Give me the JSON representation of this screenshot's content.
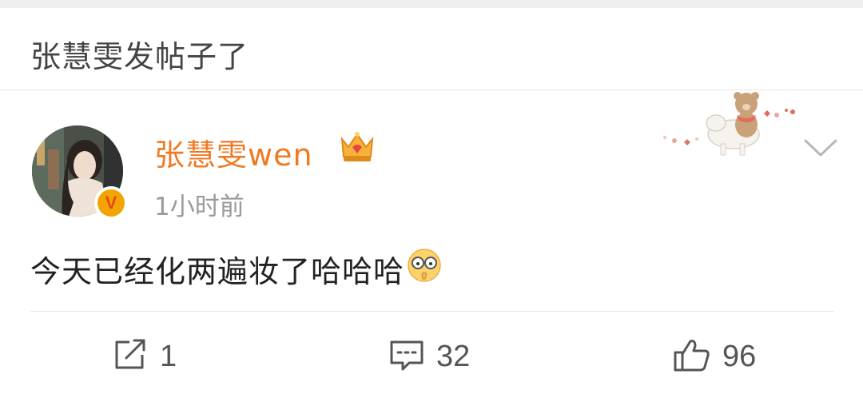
{
  "header": {
    "title": "张慧雯发帖子了"
  },
  "post": {
    "author": "张慧雯wen",
    "verified_badge": "V",
    "timestamp": "1小时前",
    "text": "今天已经化两遍妆了哈哈哈",
    "emoji": "glasses-face-emoji"
  },
  "actions": {
    "repost_count": "1",
    "comment_count": "32",
    "like_count": "96"
  },
  "colors": {
    "username": "#f07a24",
    "text": "#222222",
    "muted": "#9a9a9a",
    "divider": "#e6e6e6"
  }
}
